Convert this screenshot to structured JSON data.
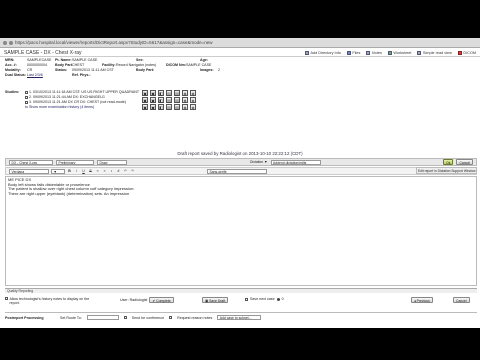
{
  "browser": {
    "url": "https://pacs.hospital.local/viewer/reports/DictReport.aspx?StudyID=5617&assign=case&mode=new"
  },
  "window": {
    "title": "SAMPLE CASE - DX - Chest X-ray",
    "links": [
      {
        "label": "Add Directory Info",
        "icon": "directory-icon"
      },
      {
        "label": "Files",
        "icon": "files-icon"
      },
      {
        "label": "Notes",
        "icon": "notes-icon"
      },
      {
        "label": "Worksheet",
        "icon": "worksheet-icon"
      },
      {
        "label": "Simple read view",
        "icon": "read-view-icon"
      },
      {
        "label": "DICOM",
        "icon": "dicom-icon"
      }
    ]
  },
  "patient": {
    "mrn_label": "MRN:",
    "mrn": "SAMPLECASE",
    "pt_name_label": "Pt. Name:",
    "pt_name": "SAMPLE CASE",
    "sex_label": "Sex:",
    "sex": "",
    "age_label": "Age:",
    "age": "",
    "acc_label": "Acc. #:",
    "acc": "0000000004",
    "bodypart_label": "Body Part:",
    "bodypart": "CHEST",
    "facility_label": "Facility:",
    "facility": "Record Navigator (notes)",
    "dicom_label": "DICOM Nm:",
    "dicom": "SAMPLE CASE",
    "modality_label": "Modality:",
    "modality": "CR",
    "status_label": "Status:",
    "status": "09/09/2013 11:11 AM CST",
    "bodypart2_label": "Body Part:",
    "bodypart2": "",
    "images_label": "Images:",
    "images": "2",
    "otherstatus_label": "Dual Status:",
    "otherstatus": "Last 2/3/6",
    "refphys_label": "Ref. Phys.:",
    "refphys": ""
  },
  "studies": {
    "label": "Studies:",
    "items": [
      "1. 03/10/2013 11:11:18 AM CST: US US RIGHT UPPER QUADRANT",
      "2. 09/09/2013 11:21:44 AM DX: EXCHANGELG",
      "3. 09/09/2013 11:21 AM DX CR DX: CHEST (not read-mode)",
      "to Show more examination history (4 items)"
    ]
  },
  "draft_notice": "Draft report saved by Radiologist on 2013-10-10 22:22:12 (CDT)",
  "editor_header": {
    "template": "DX - Chest X-ray",
    "template_mode": "Preliminary",
    "template_type": "Draw",
    "dictation_label": "Dictation ▼",
    "addendum": "Addend dictation/edits",
    "btn_1": "Ok",
    "btn_2": "Cancel"
  },
  "toolbar": {
    "font": "Verdana",
    "size": "▼",
    "bold": "B",
    "italic": "I",
    "underline": "U",
    "strike": "S",
    "font2": "Sans-serife",
    "right_tab": "Edit report in Dictation Support Window"
  },
  "report_lines": [
    "ME PICE DX",
    "Body left shows fails distenlable or proselence",
    "The patient is shallow over right chest column cuff category impression:",
    "There are right upper (eyeblank) (determination) sets. An impression"
  ],
  "quality_label": "Quality Reporting",
  "actions": {
    "allow_history": "Allow technologist's history notes to display on the report.",
    "user_label": "User: Radiologist",
    "complete": "Complete",
    "save_draft": "Save Draft",
    "save_next": "Save next case",
    "count": "0",
    "previous": "Previous",
    "cancel": "Cancel"
  },
  "footer": {
    "label": "Postreport Processing",
    "set_route_label": "Set Route To:",
    "fax": "Send for conference",
    "consult": "Request reason notes",
    "add_case": "Add case to subset..."
  }
}
